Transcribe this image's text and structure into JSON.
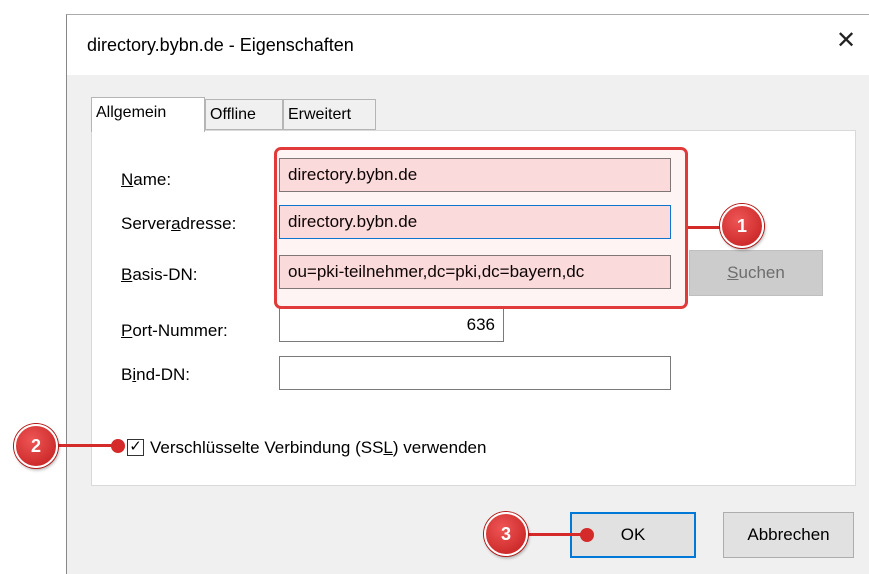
{
  "window": {
    "title": "directory.bybn.de - Eigenschaften",
    "close_glyph": "✕"
  },
  "tabs": [
    {
      "label": "Allgemein",
      "active": true
    },
    {
      "label": "Offline",
      "active": false
    },
    {
      "label": "Erweitert",
      "active": false
    }
  ],
  "form": {
    "name": {
      "label_pre": "",
      "label_u": "N",
      "label_post": "ame:",
      "value": "directory.bybn.de"
    },
    "server": {
      "label_pre": "Server",
      "label_u": "a",
      "label_post": "dresse:",
      "value": "directory.bybn.de"
    },
    "base_dn": {
      "label_pre": "",
      "label_u": "B",
      "label_post": "asis-DN:",
      "value": "ou=pki-teilnehmer,dc=pki,dc=bayern,dc"
    },
    "port": {
      "label_pre": "",
      "label_u": "P",
      "label_post": "ort-Nummer:",
      "value": "636"
    },
    "bind_dn": {
      "label_pre": "B",
      "label_u": "i",
      "label_post": "nd-DN:",
      "value": ""
    },
    "search_button": {
      "label_u": "S",
      "label_post": "uchen"
    }
  },
  "ssl": {
    "checked": true,
    "check_glyph": "✓",
    "label_pre": "Verschlüsselte Verbindung (SS",
    "label_u": "L",
    "label_post": ") verwenden"
  },
  "buttons": {
    "ok": "OK",
    "cancel": "Abbrechen"
  },
  "annotations": {
    "m1": "1",
    "m2": "2",
    "m3": "3",
    "color": "#d42a2a"
  }
}
